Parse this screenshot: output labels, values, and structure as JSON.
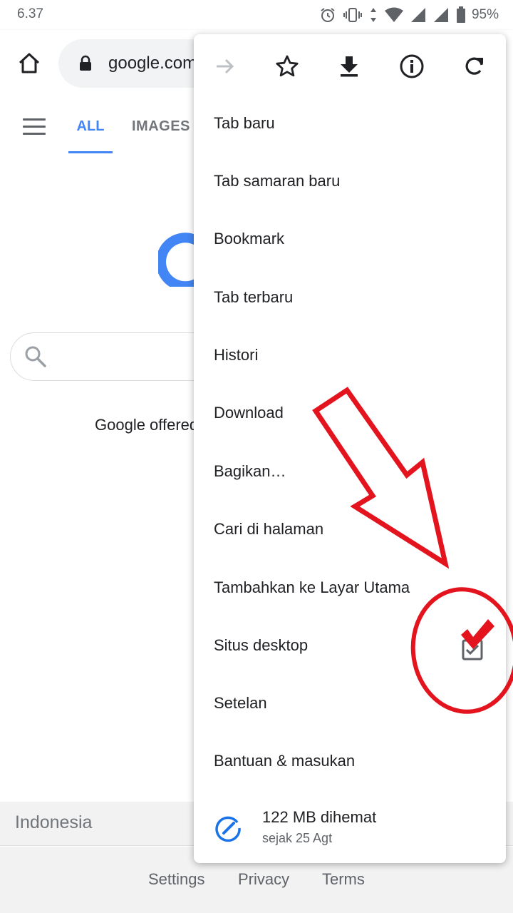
{
  "status_bar": {
    "time": "6.37",
    "battery": "95%",
    "icons": [
      "alarm-icon",
      "vibrate-icon",
      "data-arrows-icon",
      "wifi-icon",
      "signal-icon",
      "signal-icon",
      "battery-icon"
    ]
  },
  "toolbar": {
    "url": "google.com",
    "home_icon": "home-icon",
    "lock_icon": "lock-icon"
  },
  "page": {
    "tabs": [
      "ALL",
      "IMAGES"
    ],
    "active_tab": "ALL",
    "offered_text": "Google offered",
    "footer": {
      "country": "Indonesia",
      "links": [
        "Settings",
        "Privacy",
        "Terms"
      ]
    },
    "colors": {
      "accent": "#4285f4"
    }
  },
  "menu": {
    "icon_row": [
      "forward-icon",
      "bookmark-star-icon",
      "download-icon",
      "info-icon",
      "reload-icon"
    ],
    "items": [
      "Tab baru",
      "Tab samaran baru",
      "Bookmark",
      "Tab terbaru",
      "Histori",
      "Download",
      "Bagikan…",
      "Cari di halaman",
      "Tambahkan ke Layar Utama",
      "Situs desktop",
      "Setelan",
      "Bantuan & masukan"
    ],
    "desktop_site_checked": true,
    "data_saver": {
      "title": "122 MB dihemat",
      "subtitle": "sejak 25 Agt"
    }
  },
  "annotation": {
    "color": "#e4141f",
    "shapes": [
      "arrow",
      "circle",
      "checkmark"
    ]
  }
}
